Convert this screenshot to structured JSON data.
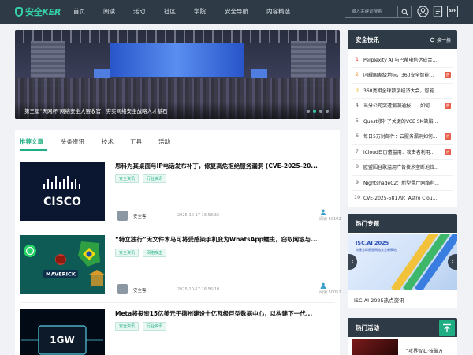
{
  "nav": {
    "logo_prefix": "安全",
    "logo_suffix": "KER",
    "items": [
      "首页",
      "阅读",
      "活动",
      "社区",
      "学院",
      "安全导航",
      "内容精选"
    ],
    "search_placeholder": "输入关键词搜索",
    "app_label": "APP"
  },
  "banner": {
    "caption": "第三届\"天网杯\"网络安全大赛收官，夯实网络安全战略人才基石",
    "slides": 4,
    "active_slide": 1
  },
  "tabs": [
    "推荐文章",
    "头条资讯",
    "技术",
    "工具",
    "活动"
  ],
  "articles": [
    {
      "title": "思科为其桌面与IP电话发布补丁，修复高危拒绝服务漏洞 (CVE-2025-20...",
      "tags": [
        "安全资讯",
        "行业资讯"
      ],
      "author": "安全客",
      "date": "2025-10-17 16:58:32",
      "reads": "阅读 50192",
      "image_label": "CISCO"
    },
    {
      "title": "“特立独行”无文件木马可将受感染手机变为WhatsApp蠕虫，窃取网银与...",
      "tags": [
        "安全资讯",
        "网络攻击"
      ],
      "author": "安全客",
      "date": "2025-10-17 16:56:10",
      "reads": "阅读 50052",
      "image_label": "MAVERICK"
    },
    {
      "title": "Meta将投资15亿美元于德州建设十亿瓦级巨型数据中心，以构建下一代...",
      "tags": [
        "安全资讯",
        "行业资讯"
      ],
      "author": "",
      "date": "",
      "reads": "",
      "image_label": "1GW"
    }
  ],
  "sidebar": {
    "quick_title": "安全快讯",
    "refresh_label": "换一换",
    "news": [
      {
        "num": "1",
        "text": "Perplexity AI 与巴蒂电信达成合...",
        "hot": false
      },
      {
        "num": "2",
        "text": "闪耀国家级地标，360安全智能...",
        "hot": true
      },
      {
        "num": "3",
        "text": "360亮相全球数字经济大会，智能...",
        "hot": false
      },
      {
        "num": "4",
        "text": "当分公司突遭漏洞通报……如何...",
        "hot": true
      },
      {
        "num": "5",
        "text": "Quest修补了关键的VCE SM缺陷...",
        "hot": false
      },
      {
        "num": "6",
        "text": "每日5万封邮件：云服务漏洞如何...",
        "hot": true
      },
      {
        "num": "7",
        "text": "iCloud日历遭滥用：攻击者利用...",
        "hot": true
      },
      {
        "num": "8",
        "text": "欧盟因谷歌滥用广告技术垄断地位...",
        "hot": false
      },
      {
        "num": "9",
        "text": "NightshadeC2：新型僵尸网络利...",
        "hot": false
      },
      {
        "num": "10",
        "text": "CVE-2025-58179：Astro Clou...",
        "hot": false
      }
    ],
    "hot_info_title": "热门专题",
    "hot_info_image_title": "ISC.AI 2025",
    "hot_info_image_sub": "构建全球数智网络安全新高地",
    "hot_info_caption": "ISC.AI 2025热点资讯",
    "activity_title": "热门活动",
    "activity_text": "“攻界智汇·技破万"
  },
  "colors": {
    "nav_bg": "#2e3b46",
    "accent": "#1fae83",
    "hot_badge": "#e85c4a"
  }
}
